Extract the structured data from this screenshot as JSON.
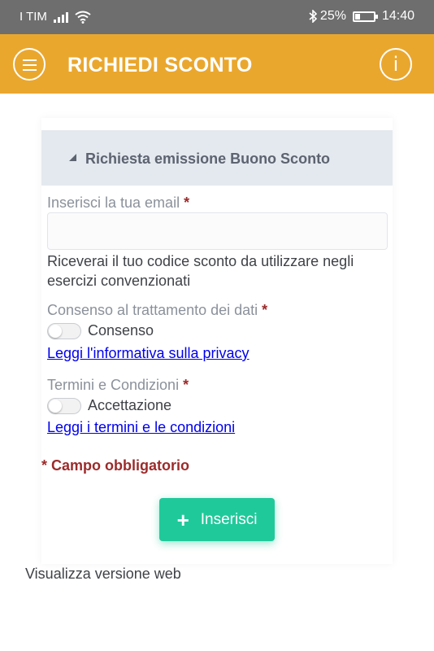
{
  "status_bar": {
    "carrier": "I TIM",
    "battery": "25%",
    "time": "14:40",
    "icons": [
      "signal-icon",
      "wifi-icon",
      "bluetooth-icon",
      "battery-icon"
    ]
  },
  "app_bar": {
    "title": "RICHIEDI SCONTO",
    "info_glyph": "i",
    "background": "#eaa72e"
  },
  "form": {
    "panel_title": "Richiesta emissione Buono Sconto",
    "email_label": "Inserisci la tua email",
    "required_mark": "*",
    "email_value": "",
    "email_help": "Riceverai il tuo codice sconto da utilizzare negli esercizi convenzionati",
    "consent_label": "Consenso al trattamento dei dati",
    "consent_toggle_label": "Consenso",
    "consent_checked": false,
    "privacy_link": "Leggi l'informativa sulla privacy",
    "terms_label": "Termini e Condizioni",
    "terms_toggle_label": "Accettazione",
    "terms_checked": false,
    "terms_link": "Leggi i termini e le condizioni",
    "required_note": "* Campo obbligatorio",
    "submit_icon": "+",
    "submit_label": "Inserisci",
    "submit_color": "#20c99a"
  },
  "footer": {
    "web_version_link": "Visualizza versione web"
  }
}
